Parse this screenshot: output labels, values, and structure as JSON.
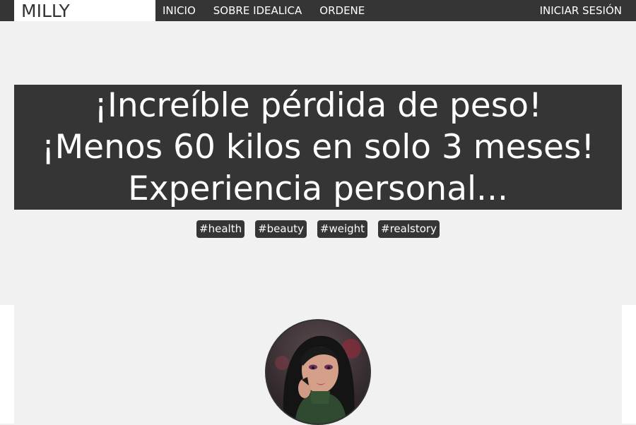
{
  "nav": {
    "logo": "MILLY",
    "links": [
      "INICIO",
      "SOBRE IDEALICA",
      "ORDENE"
    ],
    "login": "INICIAR SESIÓN"
  },
  "hero": {
    "title_lines": [
      "¡Increíble pérdida de peso!",
      "¡Menos 60 kilos en solo 3 meses!",
      "Experiencia personal..."
    ],
    "tags": [
      "#health",
      "#beauty",
      "#weight",
      "#realstory"
    ]
  },
  "colors": {
    "dark": "#353535",
    "light": "#f1f1f1",
    "white": "#ffffff"
  },
  "icons": {
    "avatar": "author-avatar-photo"
  }
}
